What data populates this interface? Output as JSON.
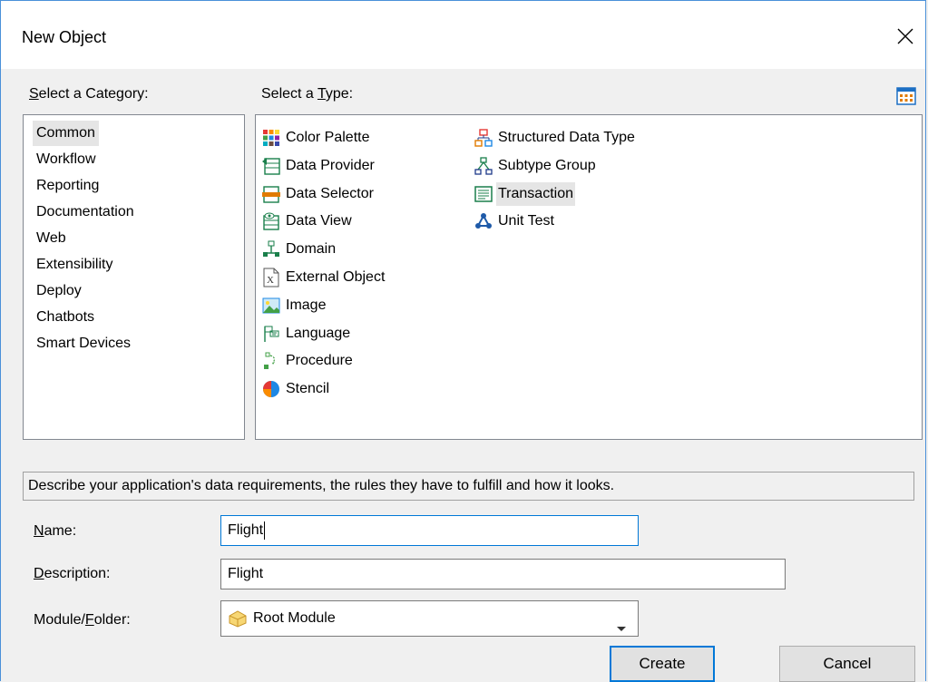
{
  "dialog": {
    "title": "New Object"
  },
  "labels": {
    "category": "Select a Category:",
    "type": "Select a Type:",
    "name": "Name:",
    "description": "Description:",
    "module": "Module/Folder:"
  },
  "categories": [
    "Common",
    "Workflow",
    "Reporting",
    "Documentation",
    "Web",
    "Extensibility",
    "Deploy",
    "Chatbots",
    "Smart Devices"
  ],
  "selected_category": "Common",
  "types": [
    {
      "label": "Color Palette",
      "icon": "color-palette-icon"
    },
    {
      "label": "Data Provider",
      "icon": "data-provider-icon"
    },
    {
      "label": "Data Selector",
      "icon": "data-selector-icon"
    },
    {
      "label": "Data View",
      "icon": "data-view-icon"
    },
    {
      "label": "Domain",
      "icon": "domain-icon"
    },
    {
      "label": "External Object",
      "icon": "external-object-icon"
    },
    {
      "label": "Image",
      "icon": "image-icon"
    },
    {
      "label": "Language",
      "icon": "language-icon"
    },
    {
      "label": "Procedure",
      "icon": "procedure-icon"
    },
    {
      "label": "Stencil",
      "icon": "stencil-icon"
    },
    {
      "label": "Structured Data Type",
      "icon": "structured-data-type-icon"
    },
    {
      "label": "Subtype Group",
      "icon": "subtype-group-icon"
    },
    {
      "label": "Transaction",
      "icon": "transaction-icon"
    },
    {
      "label": "Unit Test",
      "icon": "unit-test-icon"
    }
  ],
  "selected_type": "Transaction",
  "type_description": "Describe your application's data requirements, the rules they have to fulfill and how it looks.",
  "form": {
    "name_value": "Flight",
    "description_value": "Flight",
    "module_value": "Root Module"
  },
  "buttons": {
    "create": "Create",
    "cancel": "Cancel"
  },
  "colors": {
    "accent": "#0078d7",
    "selection": "#e5e5e5"
  }
}
